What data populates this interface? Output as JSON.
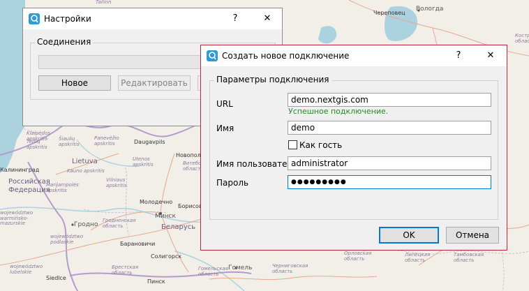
{
  "map": {
    "labels": [
      {
        "id": "tallinn",
        "text": "Tallinn"
      },
      {
        "id": "cherepovets",
        "text": "Череповец"
      },
      {
        "id": "vologda",
        "text": "Вологда"
      },
      {
        "id": "kostroma",
        "text": "Костромская область"
      },
      {
        "id": "lietuva",
        "text": "Lietuva"
      },
      {
        "id": "kaunas",
        "text": "Kauno apskritis"
      },
      {
        "id": "kaliningrad",
        "text": "Калининград"
      },
      {
        "id": "rossiyskaya",
        "text": "Российская Федерация"
      },
      {
        "id": "daugavpils",
        "text": "Daugavpils"
      },
      {
        "id": "novopolotsk",
        "text": "Новополоцк"
      },
      {
        "id": "vitebsk",
        "text": "Витебская область"
      },
      {
        "id": "molodechno",
        "text": "Молодечно"
      },
      {
        "id": "borisov",
        "text": "Борисов"
      },
      {
        "id": "minsk",
        "text": "Минск"
      },
      {
        "id": "belarus",
        "text": "Беларусь"
      },
      {
        "id": "grodno",
        "text": "Гродно"
      },
      {
        "id": "grodno-obl",
        "text": "Гродненская область"
      },
      {
        "id": "baranovichi",
        "text": "Барановичи"
      },
      {
        "id": "soligorsk",
        "text": "Солигорск"
      },
      {
        "id": "brest-obl",
        "text": "Брестская область"
      },
      {
        "id": "pinsk",
        "text": "Пинск"
      },
      {
        "id": "gomel",
        "text": "Гомель"
      },
      {
        "id": "gomel-obl",
        "text": "Гомельская область"
      },
      {
        "id": "siedlce",
        "text": "Siedlce"
      },
      {
        "id": "chernigov",
        "text": "Черниговская область"
      },
      {
        "id": "orel",
        "text": "Орловская область"
      },
      {
        "id": "lipetsk",
        "text": "Липецкая область"
      },
      {
        "id": "tambov",
        "text": "Тамбовская область"
      },
      {
        "id": "panevezys",
        "text": "Panevėžio apskritis"
      },
      {
        "id": "telsiai",
        "text": "Telšių apskritis"
      },
      {
        "id": "marijampole",
        "text": "Marijampolės apskritis"
      },
      {
        "id": "vilnius",
        "text": "Vilniaus apskritis"
      },
      {
        "id": "utena",
        "text": "Utenos apskritis"
      },
      {
        "id": "warm",
        "text": "województwo warmińsko-mazurskie"
      },
      {
        "id": "podl",
        "text": "województwo podlaskie"
      },
      {
        "id": "lubel",
        "text": "województwo lubelskie"
      },
      {
        "id": "klaipeda",
        "text": "Klaipėdos apskritis"
      },
      {
        "id": "saulaiu",
        "text": "Šiaulių apskritis"
      }
    ]
  },
  "settings_window": {
    "title": "Настройки",
    "help_label": "?",
    "close_label": "✕",
    "group_title": "Соединения",
    "buttons": {
      "new": "Новое",
      "edit": "Редактировать"
    }
  },
  "dialog": {
    "title": "Создать новое подключение",
    "help_label": "?",
    "close_label": "✕",
    "group_title": "Параметры подключения",
    "url_label": "URL",
    "url_value": "demo.nextgis.com",
    "status_text": "Успешное подключение.",
    "name_label": "Имя",
    "name_value": "demo",
    "guest_label": "Как гость",
    "guest_checked": false,
    "user_label": "Имя пользователя",
    "user_value": "administrator",
    "password_label": "Пароль",
    "password_value": "●●●●●●●●●",
    "ok_label": "OK",
    "cancel_label": "Отмена"
  },
  "colors": {
    "dialog_border": "#c0243a",
    "focus_border": "#0078d7",
    "success_text": "#1f8b1f",
    "window_bg": "#f0f0f0"
  },
  "icons": {
    "app_icon": "nextgis-qgis-icon"
  }
}
